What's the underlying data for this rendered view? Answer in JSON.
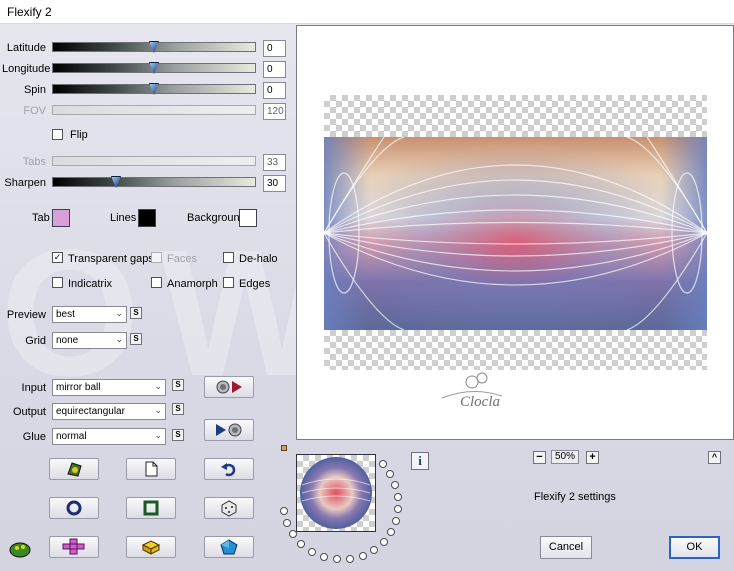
{
  "window": {
    "title": "Flexify 2"
  },
  "watermark_text": "OW",
  "sliders": [
    {
      "label": "Latitude",
      "value": "0",
      "enabled": true,
      "level": 0.5
    },
    {
      "label": "Longitude",
      "value": "0",
      "enabled": true,
      "level": 0.5
    },
    {
      "label": "Spin",
      "value": "0",
      "enabled": true,
      "level": 0.5
    },
    {
      "label": "FOV",
      "value": "120",
      "enabled": false
    },
    {
      "label": "Tabs",
      "value": "33",
      "enabled": false
    },
    {
      "label": "Sharpen",
      "value": "30",
      "enabled": true,
      "level": 0.3
    }
  ],
  "flip": {
    "label": "Flip",
    "checked": false
  },
  "colors": {
    "tab": {
      "label": "Tab",
      "color": "#d8a0d8"
    },
    "lines": {
      "label": "Lines",
      "color": "#000000"
    },
    "background": {
      "label": "Background",
      "color": "#ffffff"
    }
  },
  "options": {
    "transparent_gaps": {
      "label": "Transparent gaps",
      "checked": true
    },
    "faces": {
      "label": "Faces",
      "checked": false,
      "enabled": false
    },
    "de_halo": {
      "label": "De-halo",
      "checked": false
    },
    "indicatrix": {
      "label": "Indicatrix",
      "checked": false
    },
    "anamorph": {
      "label": "Anamorph",
      "checked": false
    },
    "edges": {
      "label": "Edges",
      "checked": false
    }
  },
  "preview_select": {
    "label": "Preview",
    "value": "best"
  },
  "grid_select": {
    "label": "Grid",
    "value": "none"
  },
  "input_select": {
    "label": "Input",
    "value": "mirror ball"
  },
  "output_select": {
    "label": "Output",
    "value": "equirectangular"
  },
  "glue_select": {
    "label": "Glue",
    "value": "normal"
  },
  "s_button_label": "S",
  "zoom": {
    "value": "50%",
    "minus": "−",
    "plus": "+"
  },
  "info_glyph": "i",
  "collapse_glyph": "^",
  "settings_caption": "Flexify 2 settings",
  "buttons": {
    "cancel": "Cancel",
    "ok": "OK"
  },
  "signature_text": "Clocla",
  "icons": [
    "swap-input-output-icon",
    "swap-output-input-icon",
    "randomize-icon",
    "new-document-icon",
    "undo-icon",
    "ring-icon",
    "square-frame-icon",
    "dice-icon",
    "flexify-logo-icon",
    "cube-net-icon",
    "cube-icon",
    "polyhedron-icon"
  ],
  "accent": "#2a64c8"
}
